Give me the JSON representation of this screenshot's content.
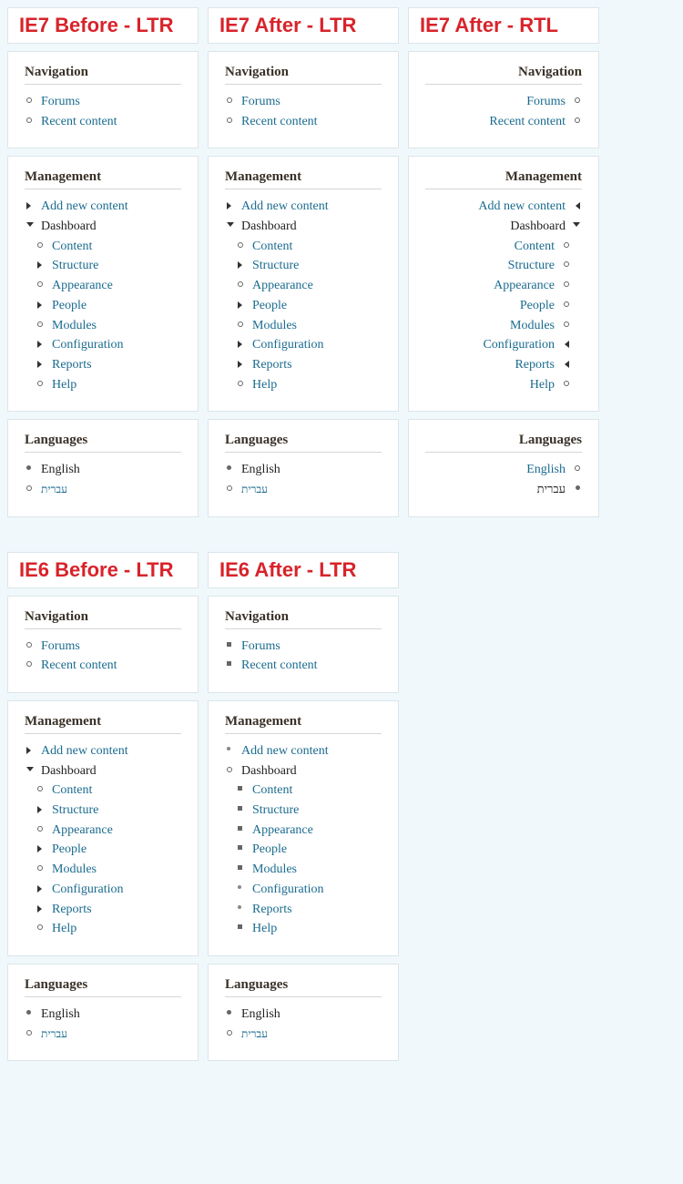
{
  "panels": {
    "ie7_before_ltr": "IE7 Before - LTR",
    "ie7_after_ltr": "IE7 After - LTR",
    "ie7_after_rtl": "IE7 After - RTL",
    "ie6_before_ltr": "IE6 Before - LTR",
    "ie6_after_ltr": "IE6 After - LTR"
  },
  "blocks": {
    "navigation": "Navigation",
    "management": "Management",
    "languages": "Languages"
  },
  "nav": {
    "forums": "Forums",
    "recent": "Recent content"
  },
  "mgmt": {
    "add": "Add new content",
    "dashboard": "Dashboard",
    "content": "Content",
    "structure": "Structure",
    "appearance": "Appearance",
    "people": "People",
    "modules": "Modules",
    "configuration": "Configuration",
    "reports": "Reports",
    "help": "Help"
  },
  "lang": {
    "english": "English",
    "hebrew": "עברית"
  }
}
